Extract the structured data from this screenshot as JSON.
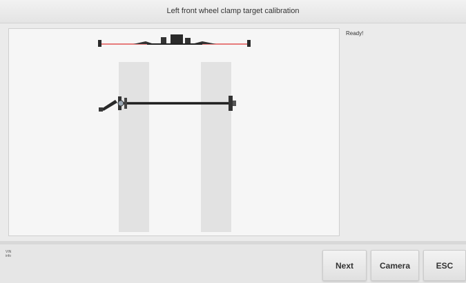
{
  "header": {
    "title": "Left front wheel clamp target calibration"
  },
  "status": {
    "text": "Ready!"
  },
  "info": {
    "line1": "VIN",
    "line2": "info"
  },
  "buttons": {
    "next": "Next",
    "camera": "Camera",
    "esc": "ESC"
  },
  "colors": {
    "accent_line": "#e05050",
    "lane": "#e2e2e2",
    "rod": "#1e1e1e"
  }
}
